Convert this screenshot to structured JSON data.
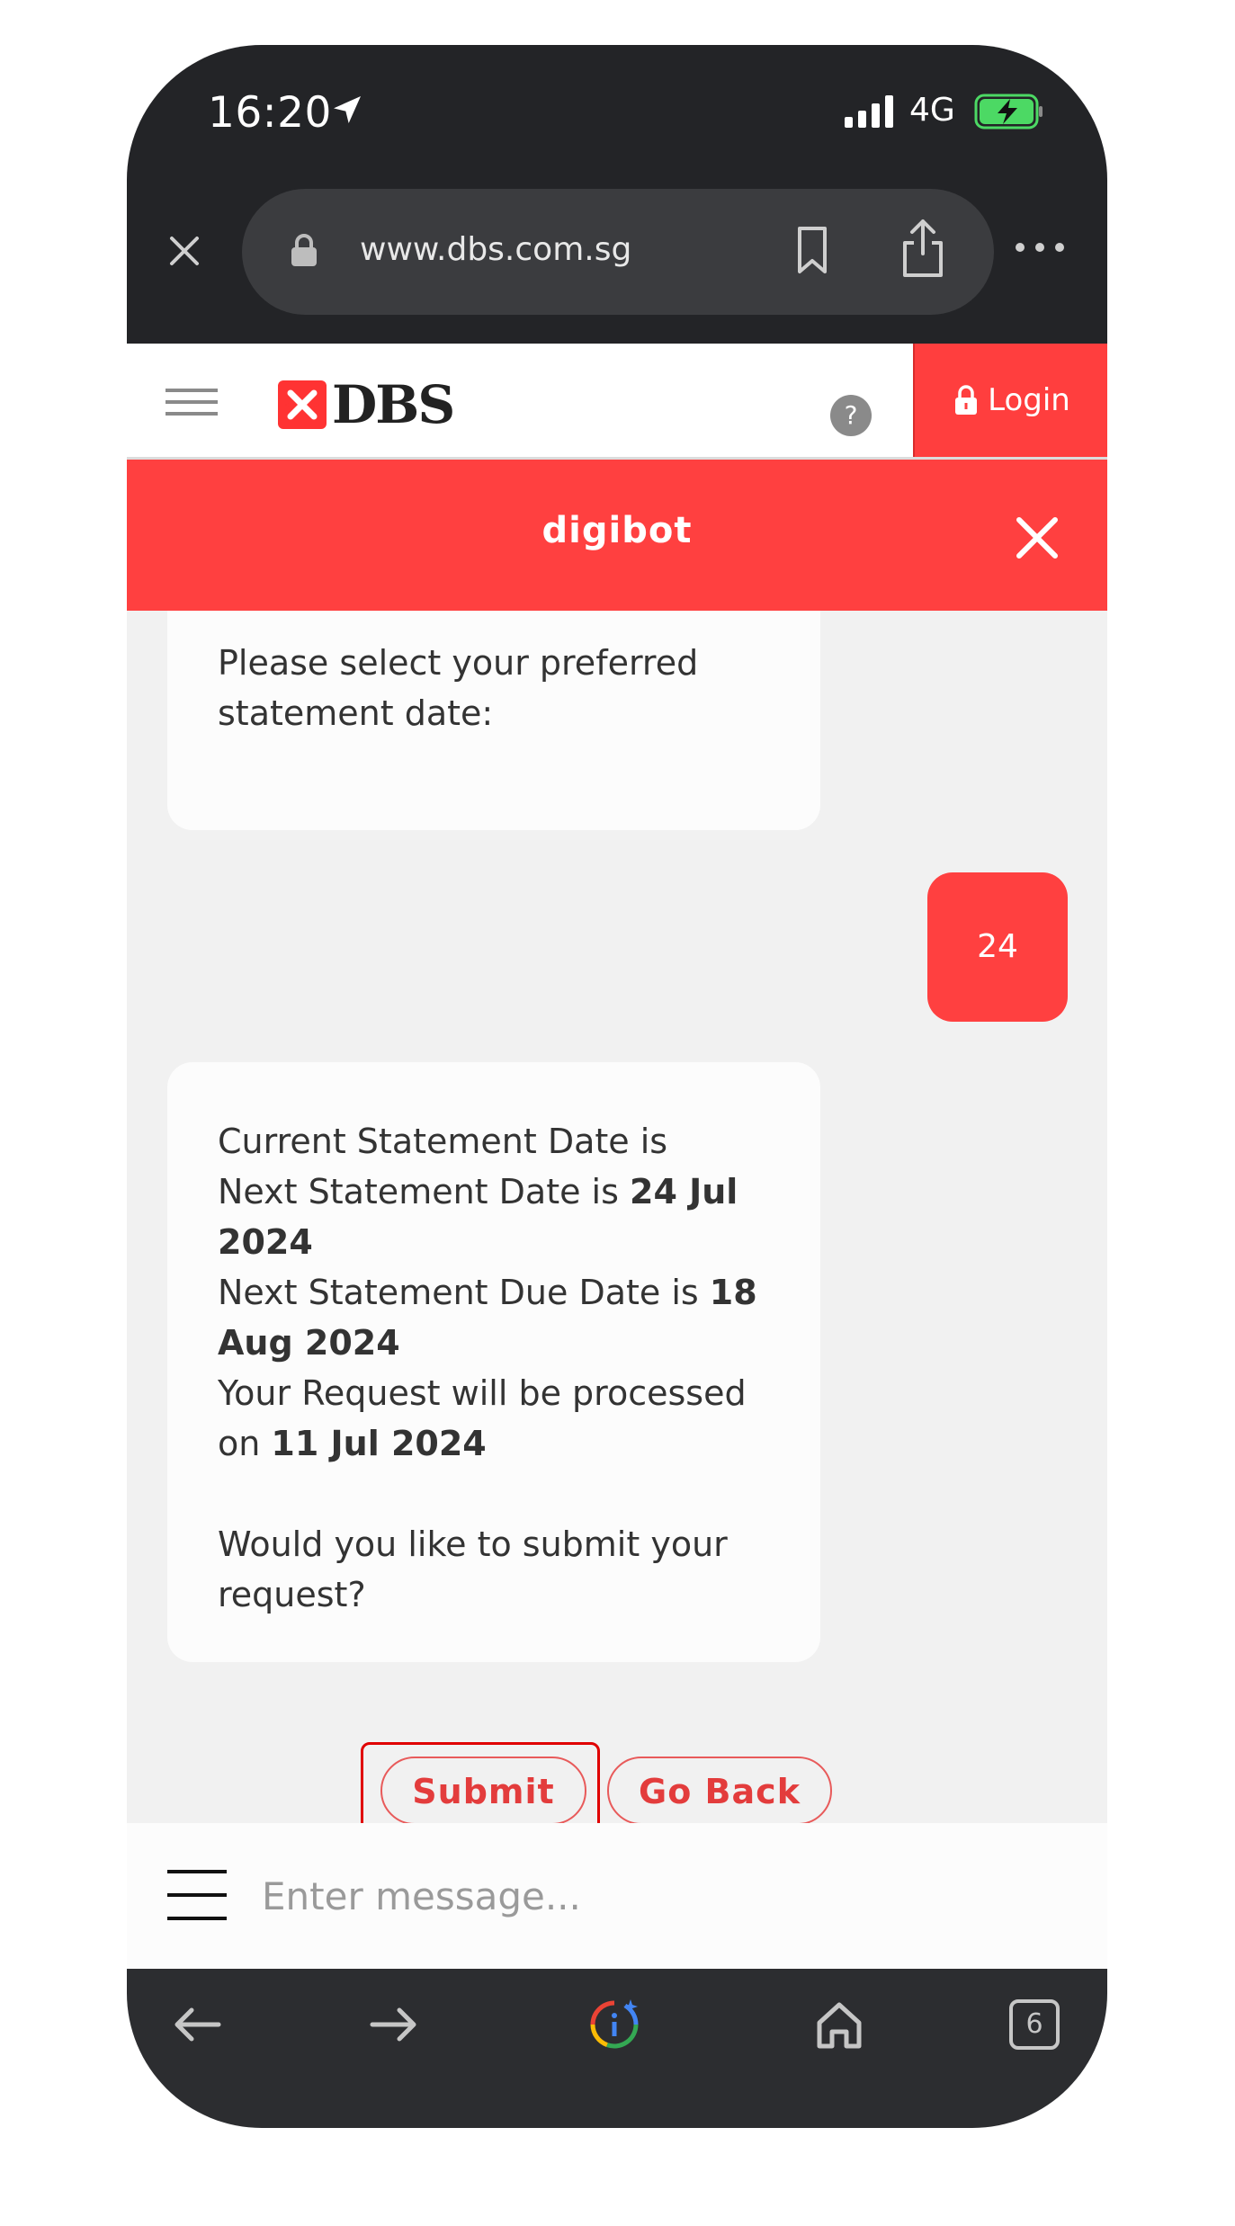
{
  "status_bar": {
    "time": "16:20",
    "network": "4G"
  },
  "browser": {
    "url": "www.dbs.com.sg",
    "tabs_count": "6"
  },
  "site_header": {
    "logo_text": "DBS",
    "help_label": "?",
    "login_label": "Login"
  },
  "chat_header": {
    "title": "digibot"
  },
  "messages": {
    "bot1": {
      "text": "Please select your preferred statement date:"
    },
    "user1": {
      "text": "24"
    },
    "bot2": {
      "line1": "Current Statement Date is",
      "next_statement_prefix": "Next Statement Date is ",
      "next_statement_value": "24 Jul 2024",
      "due_prefix": "Next Statement Due Date is ",
      "due_value": "18 Aug 2024",
      "processed_prefix": "Your Request will be processed on ",
      "processed_value": "11 Jul 2024",
      "question": "Would you like to submit your request?"
    }
  },
  "actions": {
    "submit_label": "Submit",
    "go_back_label": "Go Back"
  },
  "composer": {
    "placeholder": "Enter message..."
  },
  "colors": {
    "accent": "#ff4040",
    "chrome": "#232427",
    "chat_bg": "#f1f1f1"
  }
}
